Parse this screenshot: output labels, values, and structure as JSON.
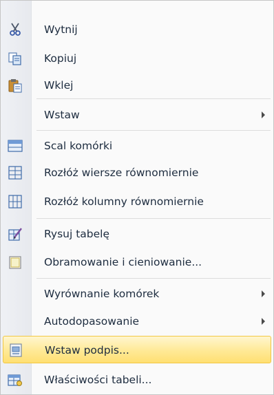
{
  "menu": {
    "items": [
      {
        "label": "Wytnij",
        "icon": "scissors-icon"
      },
      {
        "label": "Kopiuj",
        "icon": "copy-icon"
      },
      {
        "label": "Wklej",
        "icon": "paste-icon"
      },
      {
        "label": "Wstaw",
        "has_submenu": true
      },
      {
        "label": "Scal komórki",
        "icon": "merge-cells-icon"
      },
      {
        "label": "Rozłóż wiersze równomiernie",
        "icon": "distribute-rows-icon"
      },
      {
        "label": "Rozłóż kolumny równomiernie",
        "icon": "distribute-columns-icon"
      },
      {
        "label": "Rysuj tabelę",
        "icon": "draw-table-icon"
      },
      {
        "label": "Obramowanie i cieniowanie...",
        "icon": "borders-shading-icon"
      },
      {
        "label": "Wyrównanie komórek",
        "has_submenu": true
      },
      {
        "label": "Autodopasowanie",
        "has_submenu": true
      },
      {
        "label": "Wstaw podpis...",
        "icon": "insert-caption-icon",
        "highlighted": true
      },
      {
        "label": "Właściwości tabeli...",
        "icon": "table-properties-icon"
      }
    ]
  },
  "colors": {
    "text": "#1d2c3f",
    "highlight_top": "#fff6cf",
    "highlight_bottom": "#ffdf72",
    "highlight_border": "#f1c743",
    "gutter": "#eff1f5"
  }
}
